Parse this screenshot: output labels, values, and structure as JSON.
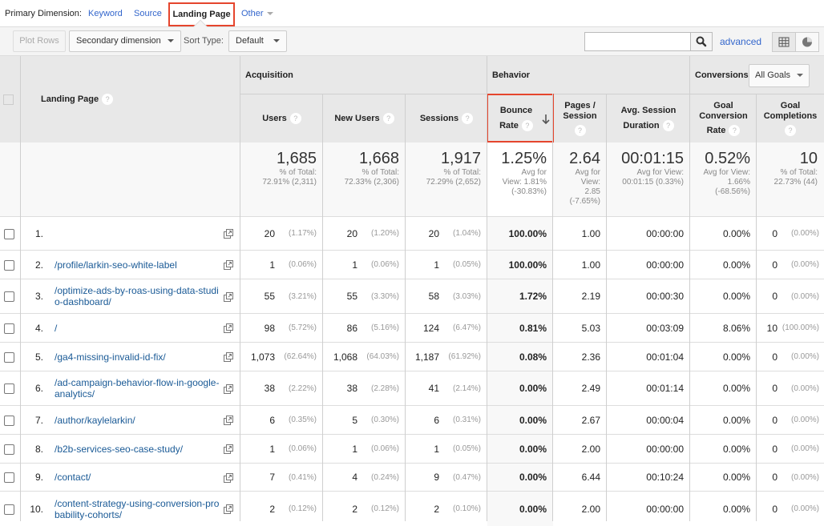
{
  "primary_dimension": {
    "label": "Primary Dimension:",
    "options": [
      "Keyword",
      "Source",
      "Landing Page",
      "Other"
    ],
    "active": "Landing Page"
  },
  "toolbar": {
    "plot_rows": "Plot Rows",
    "secondary_dimension": "Secondary dimension",
    "sort_type_label": "Sort Type:",
    "sort_type_value": "Default",
    "search_value": "",
    "search_placeholder": "",
    "advanced": "advanced"
  },
  "colors": {
    "accent_link": "#3366cc",
    "highlight_box": "#e5452d"
  },
  "table": {
    "groups": {
      "acquisition": "Acquisition",
      "behavior": "Behavior",
      "conversions": "Conversions",
      "goals_select": "All Goals"
    },
    "headers": {
      "landing_page": "Landing Page",
      "users": "Users",
      "new_users": "New Users",
      "sessions": "Sessions",
      "bounce_rate_1": "Bounce",
      "bounce_rate_2": "Rate",
      "pages_session_1": "Pages /",
      "pages_session_2": "Session",
      "avg_dur_1": "Avg. Session",
      "avg_dur_2": "Duration",
      "goal_conv_1": "Goal",
      "goal_conv_2": "Conversion",
      "goal_conv_3": "Rate",
      "goal_comp_1": "Goal",
      "goal_comp_2": "Completions",
      "help": "?"
    },
    "totals": {
      "users": {
        "value": "1,685",
        "sub1": "% of Total:",
        "sub2": "72.91% (2,311)"
      },
      "new_users": {
        "value": "1,668",
        "sub1": "% of Total:",
        "sub2": "72.33% (2,306)"
      },
      "sessions": {
        "value": "1,917",
        "sub1": "% of Total:",
        "sub2": "72.29% (2,652)"
      },
      "bounce_rate": {
        "value": "1.25%",
        "sub1": "Avg for",
        "sub2": "View: 1.81%",
        "sub3": "(-30.83%)"
      },
      "pages_session": {
        "value": "2.64",
        "sub1": "Avg for",
        "sub2": "View:",
        "sub3": "2.85",
        "sub4": "(-7.65%)"
      },
      "avg_duration": {
        "value": "00:01:15",
        "sub1": "Avg for View:",
        "sub2": "00:01:15 (0.33%)"
      },
      "goal_conv_rate": {
        "value": "0.52%",
        "sub1": "Avg for View:",
        "sub2": "1.66%",
        "sub3": "(-68.56%)"
      },
      "goal_completions": {
        "value": "10",
        "sub1": "% of Total:",
        "sub2": "22.73% (44)"
      }
    },
    "rows": [
      {
        "n": "1.",
        "page": "",
        "users": "20",
        "users_pct": "(1.17%)",
        "new_users": "20",
        "new_users_pct": "(1.20%)",
        "sessions": "20",
        "sessions_pct": "(1.04%)",
        "bounce": "100.00%",
        "pps": "1.00",
        "dur": "00:00:00",
        "gcr": "0.00%",
        "gc": "0",
        "gc_pct": "(0.00%)"
      },
      {
        "n": "2.",
        "page": "/profile/larkin-seo-white-label",
        "users": "1",
        "users_pct": "(0.06%)",
        "new_users": "1",
        "new_users_pct": "(0.06%)",
        "sessions": "1",
        "sessions_pct": "(0.05%)",
        "bounce": "100.00%",
        "pps": "1.00",
        "dur": "00:00:00",
        "gcr": "0.00%",
        "gc": "0",
        "gc_pct": "(0.00%)"
      },
      {
        "n": "3.",
        "page": "/optimize-ads-by-roas-using-data-studio-dashboard/",
        "users": "55",
        "users_pct": "(3.21%)",
        "new_users": "55",
        "new_users_pct": "(3.30%)",
        "sessions": "58",
        "sessions_pct": "(3.03%)",
        "bounce": "1.72%",
        "pps": "2.19",
        "dur": "00:00:30",
        "gcr": "0.00%",
        "gc": "0",
        "gc_pct": "(0.00%)"
      },
      {
        "n": "4.",
        "page": "/",
        "users": "98",
        "users_pct": "(5.72%)",
        "new_users": "86",
        "new_users_pct": "(5.16%)",
        "sessions": "124",
        "sessions_pct": "(6.47%)",
        "bounce": "0.81%",
        "pps": "5.03",
        "dur": "00:03:09",
        "gcr": "8.06%",
        "gc": "10",
        "gc_pct": "(100.00%)"
      },
      {
        "n": "5.",
        "page": "/ga4-missing-invalid-id-fix/",
        "users": "1,073",
        "users_pct": "(62.64%)",
        "new_users": "1,068",
        "new_users_pct": "(64.03%)",
        "sessions": "1,187",
        "sessions_pct": "(61.92%)",
        "bounce": "0.08%",
        "pps": "2.36",
        "dur": "00:01:04",
        "gcr": "0.00%",
        "gc": "0",
        "gc_pct": "(0.00%)"
      },
      {
        "n": "6.",
        "page": "/ad-campaign-behavior-flow-in-google-analytics/",
        "users": "38",
        "users_pct": "(2.22%)",
        "new_users": "38",
        "new_users_pct": "(2.28%)",
        "sessions": "41",
        "sessions_pct": "(2.14%)",
        "bounce": "0.00%",
        "pps": "2.49",
        "dur": "00:01:14",
        "gcr": "0.00%",
        "gc": "0",
        "gc_pct": "(0.00%)"
      },
      {
        "n": "7.",
        "page": "/author/kaylelarkin/",
        "users": "6",
        "users_pct": "(0.35%)",
        "new_users": "5",
        "new_users_pct": "(0.30%)",
        "sessions": "6",
        "sessions_pct": "(0.31%)",
        "bounce": "0.00%",
        "pps": "2.67",
        "dur": "00:00:04",
        "gcr": "0.00%",
        "gc": "0",
        "gc_pct": "(0.00%)"
      },
      {
        "n": "8.",
        "page": "/b2b-services-seo-case-study/",
        "users": "1",
        "users_pct": "(0.06%)",
        "new_users": "1",
        "new_users_pct": "(0.06%)",
        "sessions": "1",
        "sessions_pct": "(0.05%)",
        "bounce": "0.00%",
        "pps": "2.00",
        "dur": "00:00:00",
        "gcr": "0.00%",
        "gc": "0",
        "gc_pct": "(0.00%)"
      },
      {
        "n": "9.",
        "page": "/contact/",
        "users": "7",
        "users_pct": "(0.41%)",
        "new_users": "4",
        "new_users_pct": "(0.24%)",
        "sessions": "9",
        "sessions_pct": "(0.47%)",
        "bounce": "0.00%",
        "pps": "6.44",
        "dur": "00:10:24",
        "gcr": "0.00%",
        "gc": "0",
        "gc_pct": "(0.00%)"
      },
      {
        "n": "10.",
        "page": "/content-strategy-using-conversion-probability-cohorts/",
        "users": "2",
        "users_pct": "(0.12%)",
        "new_users": "2",
        "new_users_pct": "(0.12%)",
        "sessions": "2",
        "sessions_pct": "(0.10%)",
        "bounce": "0.00%",
        "pps": "2.00",
        "dur": "00:00:00",
        "gcr": "0.00%",
        "gc": "0",
        "gc_pct": "(0.00%)"
      }
    ]
  }
}
